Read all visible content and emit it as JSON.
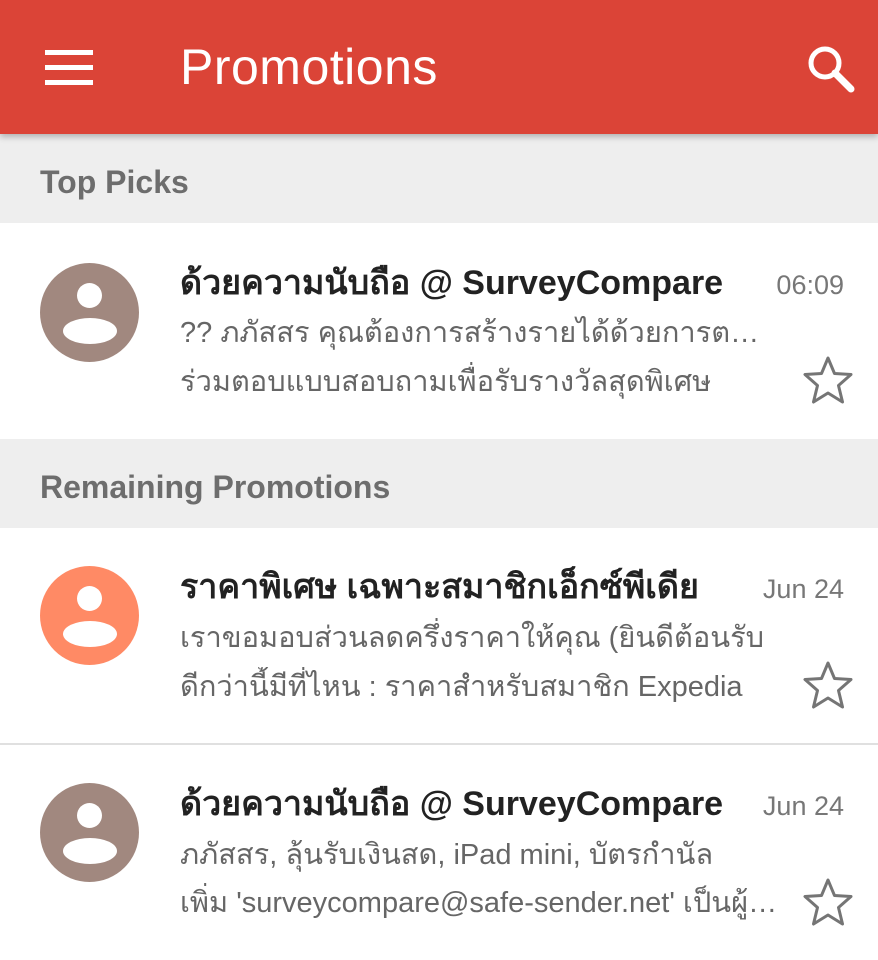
{
  "app_bar": {
    "title": "Promotions",
    "color": "#db4437",
    "menu_icon": "hamburger-menu-icon",
    "search_icon": "search-icon"
  },
  "sections": {
    "top_picks": {
      "label": "Top Picks"
    },
    "remaining": {
      "label": "Remaining Promotions"
    }
  },
  "emails": [
    {
      "sender": "ด้วยความนับถือ @ SurveyCompare",
      "date": "06:09",
      "subject": "?? ภภัสสร คุณต้องการสร้างรายได้ด้วยการตอบแบบสอบถาม",
      "snippet": "ร่วมตอบแบบสอบถามเพื่อรับรางวัลสุดพิเศษ",
      "avatar_color": "#a1887f",
      "starred": false
    },
    {
      "sender": "ราคาพิเศษ เฉพาะสมาชิกเอ็กซ์พีเดีย",
      "date": "Jun 24",
      "subject": "เราขอมอบส่วนลดครึ่งราคาให้คุณ (ยินดีต้อนรับ",
      "snippet": "ดีกว่านี้มีที่ไหน : ราคาสำหรับสมาชิก Expedia",
      "avatar_color": "#ff8a65",
      "starred": false
    },
    {
      "sender": "ด้วยความนับถือ @ SurveyCompare",
      "date": "Jun 24",
      "subject": "ภภัสสร, ลุ้นรับเงินสด, iPad mini, บัตรกำนัล",
      "snippet": "เพิ่ม 'surveycompare@safe-sender.net' เป็นผู้ติดต่อ",
      "avatar_color": "#a1887f",
      "starred": false
    }
  ]
}
